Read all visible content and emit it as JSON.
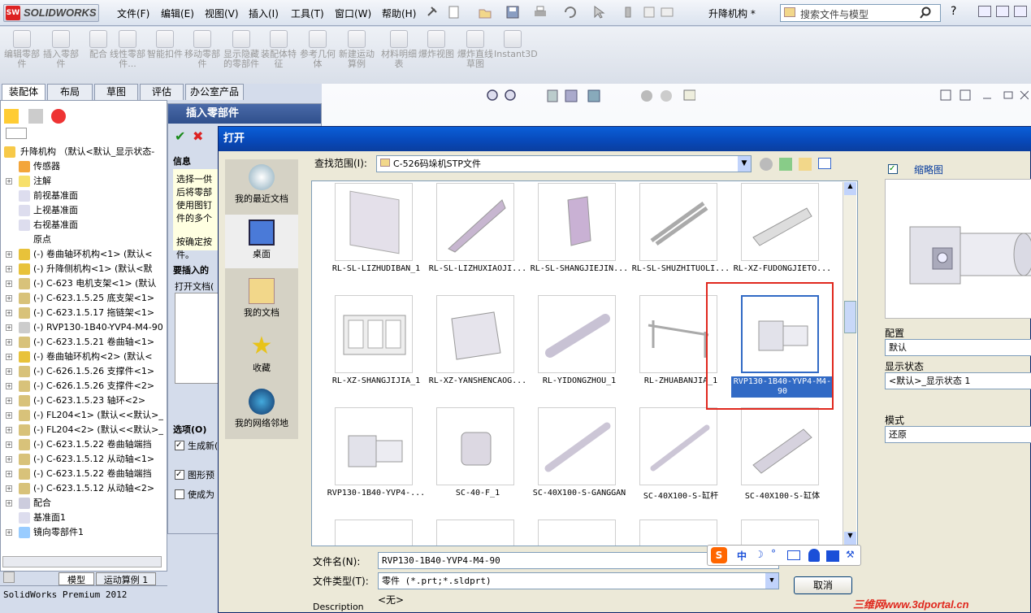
{
  "app": {
    "logo_text": "SOLIDWORKS",
    "doc_title": "升降机构 *",
    "status_text": "SolidWorks Premium 2012"
  },
  "menu": [
    "文件(F)",
    "编辑(E)",
    "视图(V)",
    "插入(I)",
    "工具(T)",
    "窗口(W)",
    "帮助(H)"
  ],
  "search": {
    "placeholder": "搜索文件与模型"
  },
  "ribbon": [
    "编辑零部件",
    "插入零部件",
    "配合",
    "线性零部件...",
    "智能扣件",
    "移动零部件",
    "显示隐藏的零部件",
    "装配体特征",
    "参考几何体",
    "新建运动算例",
    "材料明细表",
    "爆炸视图",
    "爆炸直线草图",
    "Instant3D"
  ],
  "tabs": [
    "装配体",
    "布局",
    "草图",
    "评估",
    "办公室产品"
  ],
  "tree": {
    "root": "升降机构 （默认<默认_显示状态-",
    "items": [
      "传感器",
      "注解",
      "前视基准面",
      "上视基准面",
      "右视基准面",
      "原点",
      "(-) 卷曲轴环机构<1> (默认<",
      "(-) 升降侧机构<1> (默认<默",
      "(-) C-623 电机支架<1> (默认",
      "(-) C-623.1.5.25 底支架<1>",
      "(-) C-623.1.5.17 拖链架<1>",
      "(-) RVP130-1B40-YVP4-M4-90",
      "(-) C-623.1.5.21 卷曲轴<1>",
      "(-) 卷曲轴环机构<2> (默认<",
      "(-) C-626.1.5.26 支撑件<1>",
      "(-) C-626.1.5.26 支撑件<2>",
      "(-) C-623.1.5.23 轴环<2>",
      "(-) FL204<1> (默认<<默认>_",
      "(-) FL204<2> (默认<<默认>_",
      "(-) C-623.1.5.22 卷曲轴端挡",
      "(-) C-623.1.5.12 从动轴<1>",
      "(-) C-623.1.5.22 卷曲轴端挡",
      "(-) C-623.1.5.12 从动轴<2>",
      "配合",
      "基准面1",
      "镜向零部件1"
    ]
  },
  "bottom_tabs": [
    "模型",
    "运动算例 1"
  ],
  "pm": {
    "title": "插入零部件",
    "info_header": "信息",
    "info_text": "选择一供后将零部使用图钉件的多个",
    "info_text2": "按确定按件。",
    "insert_header": "要插入的",
    "open_doc": "打开文档(",
    "options_header": "选项(O)",
    "opt1": "生成新(S)",
    "opt2": "图形预",
    "opt3": "使成为"
  },
  "dialog": {
    "title": "打开",
    "look_in_label": "查找范围(I):",
    "look_in_value": "C-526码垛机STP文件",
    "places": [
      "我的最近文档",
      "桌面",
      "我的文档",
      "收藏",
      "我的网络邻地"
    ],
    "files": [
      "RL-SL-LIZHUDIBAN_1",
      "RL-SL-LIZHUXIAOJI...",
      "RL-SL-SHANGJIEJIN...",
      "RL-SL-SHUZHITUOLI...",
      "RL-XZ-FUDONGJIETO...",
      "RL-XZ-SHANGJIJIA_1",
      "RL-XZ-YANSHENCAOG...",
      "RL-YIDONGZHOU_1",
      "RL-ZHUABANJIA_1",
      "RVP130-1B40-YVP4-M4-90",
      "RVP130-1B40-YVP4-...",
      "SC-40-F_1",
      "SC-40X100-S-GANGGAN",
      "SC-40X100-S-缸杆",
      "SC-40X100-S-缸体"
    ],
    "filename_label": "文件名(N):",
    "filename_value": "RVP130-1B40-YVP4-M4-90",
    "filetype_label": "文件类型(T):",
    "filetype_value": "零件 (*.prt;*.sldprt)",
    "description_label": "Description",
    "description_value": "<无>",
    "cancel_label": "取消",
    "thumbnail_label": "缩略图",
    "config_label": "配置",
    "config_value": "默认",
    "display_state_label": "显示状态",
    "display_state_value": "<默认>_显示状态 1",
    "mode_label": "模式",
    "mode_value": "还原"
  },
  "ime": {
    "lang": "中"
  },
  "watermark": "三维网www.3dportal.cn",
  "colors": {
    "title_bar": "#0a5fd8",
    "selection": "#316ac5",
    "highlight": "#e0281e"
  }
}
